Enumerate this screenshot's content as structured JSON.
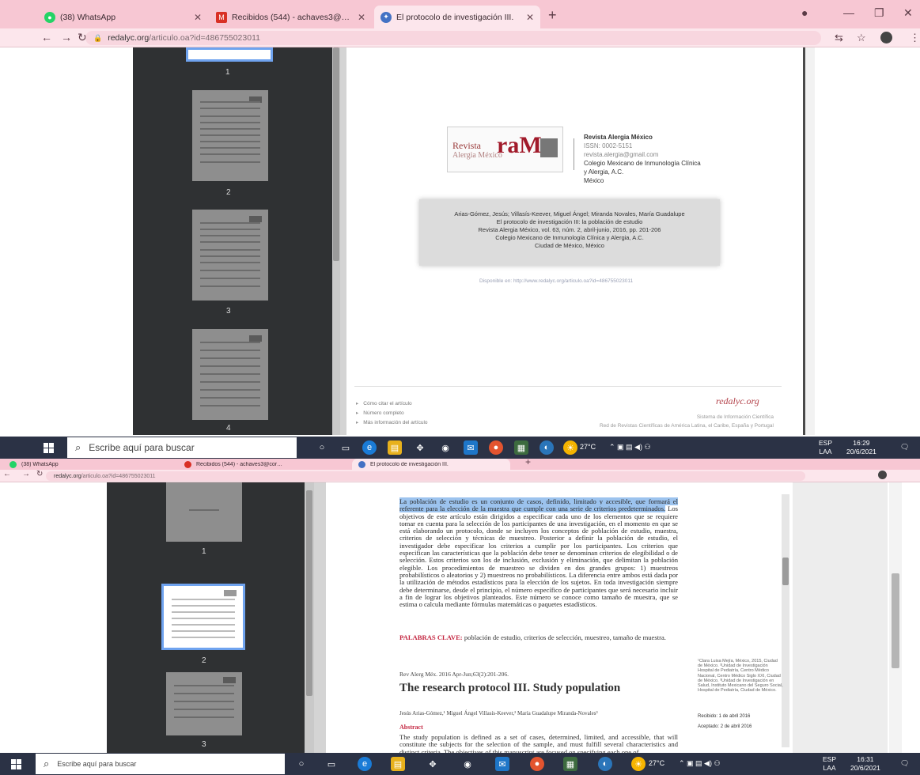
{
  "browser": {
    "tabs": [
      {
        "label": "(38) WhatsApp",
        "icon": "whatsapp-icon",
        "color": "#25d366"
      },
      {
        "label": "Recibidos (544) - achaves3@cor…",
        "icon": "gmail-icon",
        "color": "#d93025"
      },
      {
        "label": "El protocolo de investigación III.",
        "icon": "redalyc-icon",
        "color": "#4472c4"
      }
    ],
    "new_tab": "+",
    "address": {
      "domain": "redalyc.org",
      "path": "/articulo.oa?id=486755023011"
    }
  },
  "viewer_top": {
    "thumb_labels": [
      "1",
      "2",
      "3",
      "4"
    ],
    "journal": {
      "logo_revista": "Revista",
      "logo_subtitle": "Alergia México",
      "logo_big": "raM",
      "name": "Revista Alergia México",
      "issn": "ISSN: 0002-5151",
      "email": "revista.alergia@gmail.com",
      "publisher1": "Colegio Mexicano de Inmunología Clínica",
      "publisher2": "y Alergia, A.C.",
      "country": "México"
    },
    "citation": [
      "Arias-Gómez, Jesús; Villasís-Keever, Miguel Ángel; Miranda Novales, María Guadalupe",
      "El protocolo de investigación III: la población de estudio",
      "Revista Alergia México, vol. 63, núm. 2, abril-junio, 2016, pp. 201-206",
      "Colegio Mexicano de Inmunología Clínica y Alergia, A.C.",
      "Ciudad de México, México"
    ],
    "available": "Disponible en: http://www.redalyc.org/articulo.oa?id=486755023011",
    "footer_links": [
      "Cómo citar el artículo",
      "Número completo",
      "Más información del artículo"
    ],
    "redalyc_logo": "redalyc.org",
    "redalyc_tagline1": "Sistema de Información Científica",
    "redalyc_tagline2": "Red de Revistas Científicas de América Latina, el Caribe, España y Portugal"
  },
  "viewer_bottom": {
    "thumb_labels": [
      "1",
      "2",
      "3"
    ],
    "highlighted": "La población de estudio es un conjunto de casos, definido, limitado y accesible, que formará el referente para la elección de la muestra que cumple con una serie de criterios predeterminados.",
    "body": "Los objetivos de este artículo están dirigidos a especificar cada uno de los elementos que se requiere tomar en cuenta para la selección de los participantes de una investigación, en el momento en que se está elaborando un protocolo, donde se incluyen los conceptos de población de estudio, muestra, criterios de selección y técnicas de muestreo. Posterior a definir la población de estudio, el investigador debe especificar los criterios a cumplir por los participantes. Los criterios que especifican las características que la población debe tener se denominan criterios de elegibilidad o de selección. Estos criterios son los de inclusión, exclusión y eliminación, que delimitan la población elegible. Los procedimientos de muestreo se dividen en dos grandes grupos: 1) muestreos probabilísticos o aleatorios y 2) muestreos no probabilísticos. La diferencia entre ambos está dada por la utilización de métodos estadísticos para la elección de los sujetos. En toda investigación siempre debe determinarse, desde el principio, el número específico de participantes que será necesario incluir a fin de lograr los objetivos planteados. Este número se conoce como tamaño de muestra, que se estima o calcula mediante fórmulas matemáticas o paquetes estadísticos.",
    "keywords_label": "PALABRAS CLAVE:",
    "keywords": "población de estudio, criterios de selección, muestreo, tamaño de muestra.",
    "reference": "Rev Alerg Méx. 2016 Apr-Jun;63(2):201-206.",
    "title_en": "The research protocol III. Study population",
    "authors": "Jesús Arias-Gómez,¹ Miguel Ángel Villasís-Keever,² María Guadalupe Miranda-Novales³",
    "abstract_label": "Abstract",
    "abstract": "The study population is defined as a set of cases, determined, limited, and accessible, that will constitute the subjects for the selection of the sample, and must fulfill several characteristics and distinct criteria. The objectives of this manuscript are focused on specifying each one of",
    "sidenote": "¹Clara Luisa Mejía, México, 2015, Ciudad de México. ²Unidad de Investigación Hospital de Pediatría, Centro Médico Nacional, Centro Médico Siglo XXI, Ciudad de México. ³Unidad de Investigación en Salud, Instituto Mexicano del Seguro Social, Hospital de Pediatría, Ciudad de México.",
    "received": "Recibido: 1 de abril 2016",
    "accepted": "Aceptado: 2 de abril 2016"
  },
  "taskbar_top": {
    "search_placeholder": "Escribe aquí para buscar",
    "weather": "27°C",
    "lang1": "ESP",
    "lang2": "LAA",
    "time": "16:29",
    "date": "20/6/2021"
  },
  "taskbar_bottom": {
    "search_placeholder": "Escribe aquí para buscar",
    "weather": "27°C",
    "lang1": "ESP",
    "lang2": "LAA",
    "time": "16:31",
    "date": "20/6/2021"
  }
}
